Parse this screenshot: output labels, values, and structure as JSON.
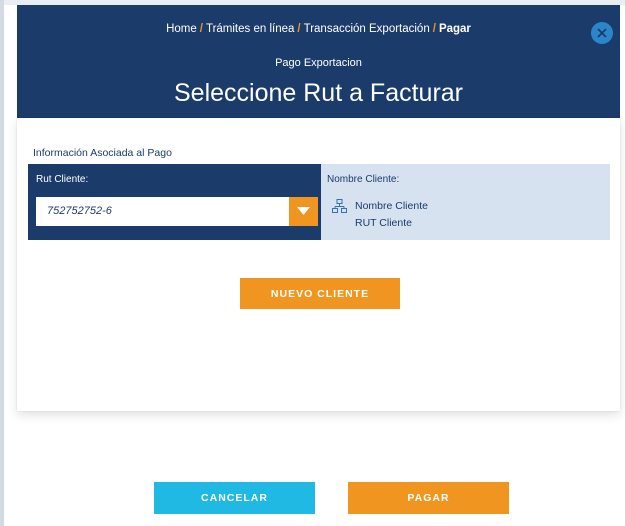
{
  "breadcrumb": {
    "home": "Home",
    "tramites": "Trámites en línea",
    "transaccion": "Transacción Exportación",
    "current": "Pagar",
    "separator": "/"
  },
  "header": {
    "subtitle": "Pago Exportacion",
    "title": "Seleccione Rut a Facturar"
  },
  "form": {
    "info_label": "Información Asociada al Pago",
    "rut_label": "Rut Cliente:",
    "rut_value": "752752752-6",
    "client_label": "Nombre Cliente:",
    "client_name": "Nombre Cliente",
    "client_rut": "RUT Cliente"
  },
  "buttons": {
    "new_client": "NUEVO CLIENTE",
    "cancel": "CANCELAR",
    "pay": "PAGAR"
  },
  "icons": {
    "close": "close-icon",
    "dropdown": "chevron-down-icon",
    "client": "org-chart-icon"
  },
  "colors": {
    "navy": "#1b3c6b",
    "orange": "#f0951f",
    "cyan": "#1fb9e4",
    "light_blue": "#d6e2ef",
    "close_blue": "#2b86c9"
  }
}
